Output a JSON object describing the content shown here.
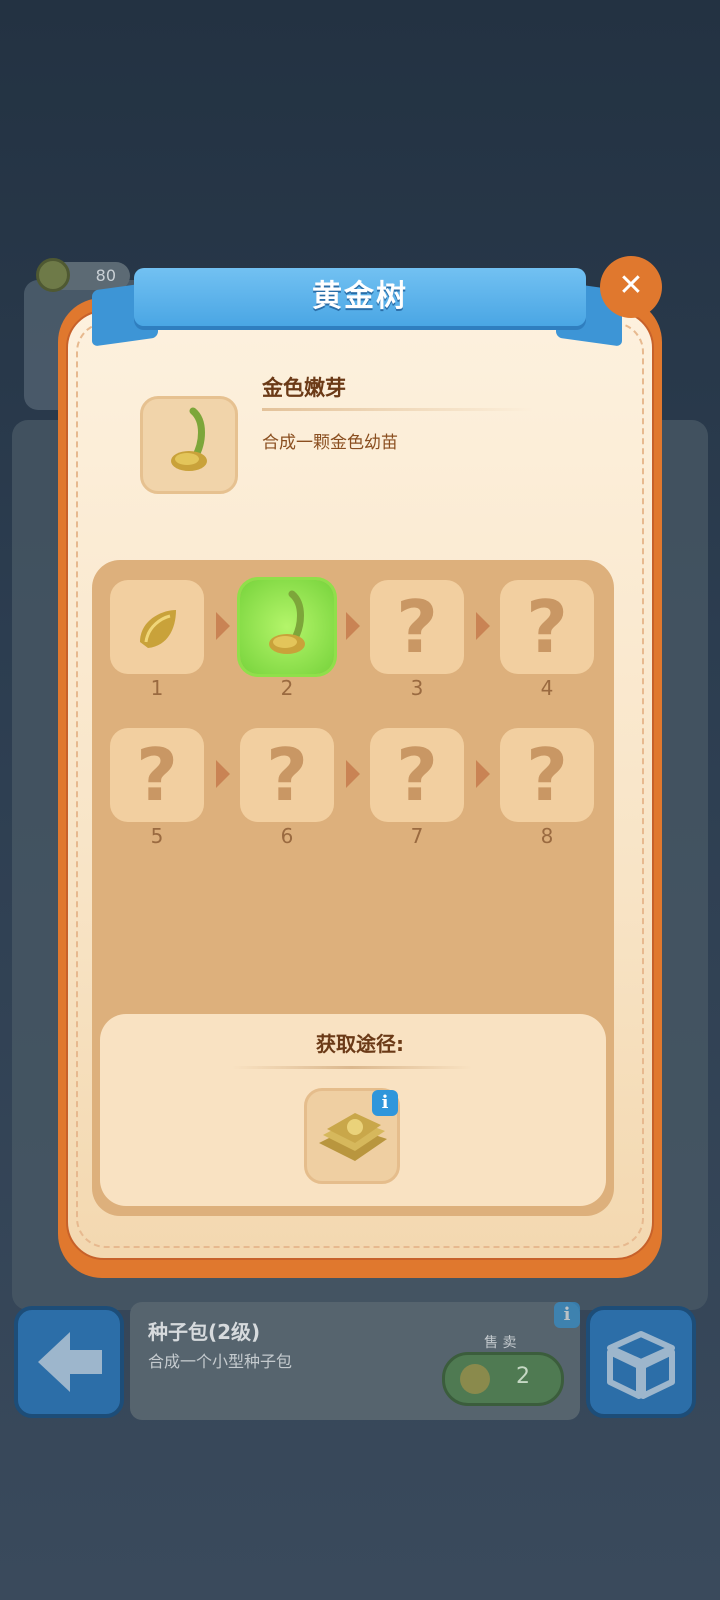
{
  "background": {
    "coins": "80",
    "bottom_panel": {
      "title": "种子包(2级)",
      "description": "合成一个小型种子包",
      "sell_label": "售 卖",
      "sell_value": "2"
    }
  },
  "dialog": {
    "title": "黄金树",
    "close_icon": "close-icon",
    "item": {
      "name": "金色嫩芽",
      "description": "合成一颗金色幼苗",
      "icon": "golden-sprout-icon"
    },
    "chain": [
      {
        "number": "1",
        "state": "unlocked",
        "icon": "golden-seed-icon"
      },
      {
        "number": "2",
        "state": "current",
        "icon": "golden-sprout-icon"
      },
      {
        "number": "3",
        "state": "locked",
        "symbol": "?"
      },
      {
        "number": "4",
        "state": "locked",
        "symbol": "?"
      },
      {
        "number": "5",
        "state": "locked",
        "symbol": "?"
      },
      {
        "number": "6",
        "state": "locked",
        "symbol": "?"
      },
      {
        "number": "7",
        "state": "locked",
        "symbol": "?"
      },
      {
        "number": "8",
        "state": "locked",
        "symbol": "?"
      }
    ],
    "source": {
      "title": "获取途径:",
      "icon": "seed-pack-icon",
      "info_icon": "i"
    }
  },
  "colors": {
    "frame_orange": "#e0782e",
    "ribbon_blue": "#4aa6e4",
    "active_green": "#77d33c"
  }
}
